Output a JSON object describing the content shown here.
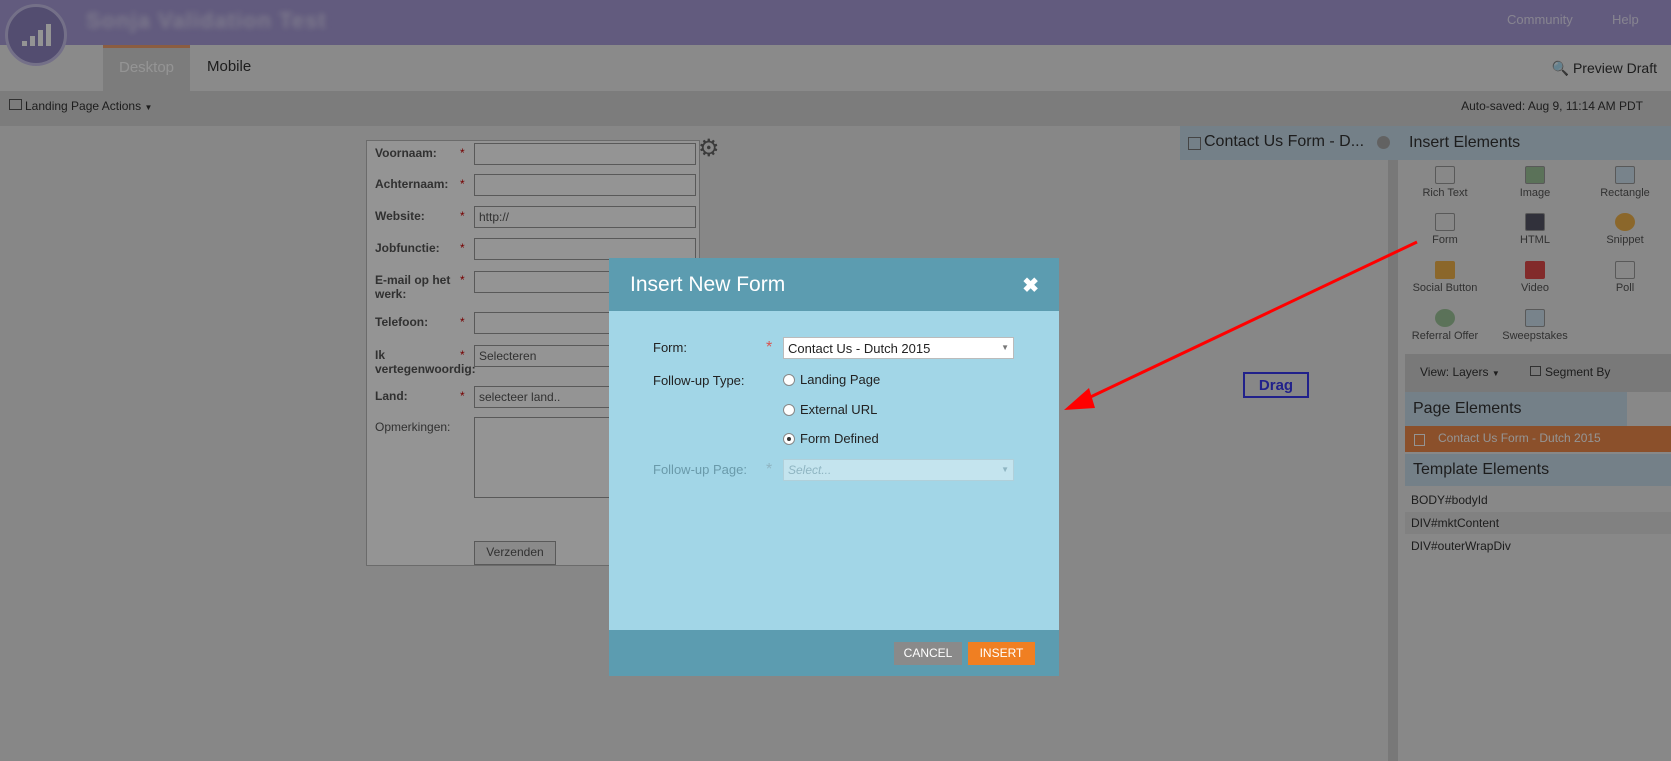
{
  "header": {
    "app_title": "Sonja Validation Test",
    "community_label": "Community",
    "help_label": "Help"
  },
  "tabs": [
    {
      "label": "Desktop"
    },
    {
      "label": "Mobile"
    }
  ],
  "preview_label": "Preview Draft",
  "toolbar": {
    "actions_label": "Landing Page Actions",
    "autosave": "Auto-saved: Aug 9, 11:14 AM PDT"
  },
  "canvas_form": {
    "fields": [
      {
        "label": "Voornaam:",
        "value": ""
      },
      {
        "label": "Achternaam:",
        "value": ""
      },
      {
        "label": "Website:",
        "value": "http://"
      },
      {
        "label": "Jobfunctie:",
        "value": ""
      },
      {
        "label": "E-mail op het werk:",
        "value": ""
      },
      {
        "label": "Telefoon:",
        "value": ""
      },
      {
        "label": "Ik vertegenwoordig:",
        "value": "Selecteren"
      },
      {
        "label": "Land:",
        "value": "selecteer land.."
      }
    ],
    "comments_label": "Opmerkingen:",
    "submit_label": "Verzenden"
  },
  "side_panel": {
    "contact_tab_title": "Contact Us Form - D...",
    "insert_elements_title": "Insert Elements",
    "elements": [
      {
        "label": "Rich Text",
        "icon": "rich-text-icon"
      },
      {
        "label": "Image",
        "icon": "image-icon"
      },
      {
        "label": "Rectangle",
        "icon": "rectangle-icon"
      },
      {
        "label": "Form",
        "icon": "form-icon"
      },
      {
        "label": "HTML",
        "icon": "html-icon"
      },
      {
        "label": "Snippet",
        "icon": "snippet-icon"
      },
      {
        "label": "Social Button",
        "icon": "social-button-icon"
      },
      {
        "label": "Video",
        "icon": "video-icon"
      },
      {
        "label": "Poll",
        "icon": "poll-icon"
      },
      {
        "label": "Referral Offer",
        "icon": "referral-offer-icon"
      },
      {
        "label": "Sweepstakes",
        "icon": "sweepstakes-icon"
      }
    ],
    "view_label": "View: Layers",
    "segment_label": "Segment By",
    "page_elements_title": "Page Elements",
    "page_element_item": "Contact Us Form - Dutch 2015",
    "template_elements_title": "Template Elements",
    "template_items": [
      "BODY#bodyId",
      "DIV#mktContent",
      "DIV#outerWrapDiv"
    ],
    "drag_label": "Drag"
  },
  "modal": {
    "title": "Insert New Form",
    "form_label": "Form:",
    "form_value": "Contact Us - Dutch 2015",
    "followup_type_label": "Follow-up Type:",
    "followup_options": [
      {
        "label": "Landing Page",
        "selected": false
      },
      {
        "label": "External URL",
        "selected": false
      },
      {
        "label": "Form Defined",
        "selected": true
      }
    ],
    "followup_page_label": "Follow-up Page:",
    "followup_page_placeholder": "Select...",
    "cancel_label": "CANCEL",
    "insert_label": "INSERT"
  },
  "colors": {
    "header": "#a99dd9",
    "modal_header": "#5c9cb0",
    "modal_body": "#a2d6e7",
    "insert_button": "#f07f22",
    "cancel_button": "#8a8a8a",
    "annotation_arrow": "#ff0000",
    "drag_box": "#3a3af0"
  }
}
